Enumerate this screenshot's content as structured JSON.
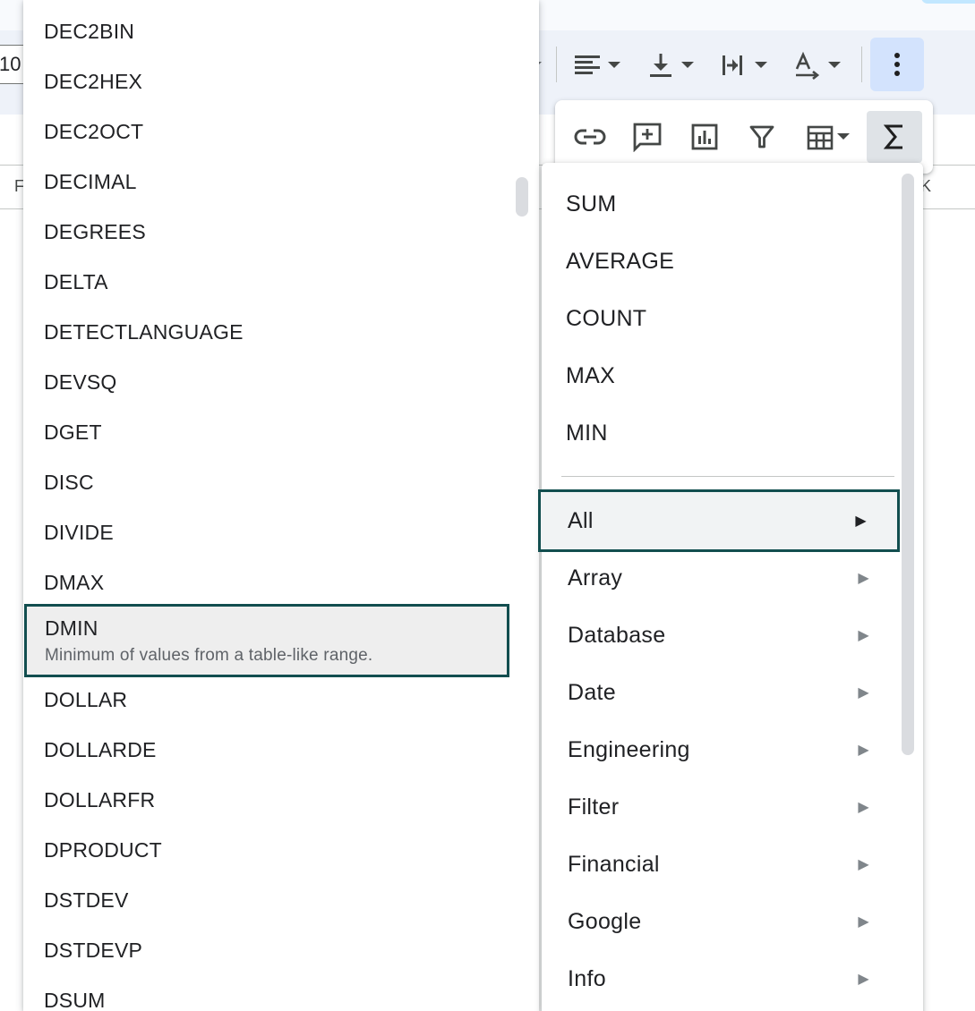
{
  "toolbar": {
    "font_size": "10",
    "col_left": "F",
    "col_right": "K"
  },
  "function_list": {
    "items": [
      {
        "name": "DEC2BIN"
      },
      {
        "name": "DEC2HEX"
      },
      {
        "name": "DEC2OCT"
      },
      {
        "name": "DECIMAL"
      },
      {
        "name": "DEGREES"
      },
      {
        "name": "DELTA"
      },
      {
        "name": "DETECTLANGUAGE"
      },
      {
        "name": "DEVSQ"
      },
      {
        "name": "DGET"
      },
      {
        "name": "DISC"
      },
      {
        "name": "DIVIDE"
      },
      {
        "name": "DMAX"
      },
      {
        "name": "DMIN",
        "description": "Minimum of values from a table-like range."
      },
      {
        "name": "DOLLAR"
      },
      {
        "name": "DOLLARDE"
      },
      {
        "name": "DOLLARFR"
      },
      {
        "name": "DPRODUCT"
      },
      {
        "name": "DSTDEV"
      },
      {
        "name": "DSTDEVP"
      },
      {
        "name": "DSUM"
      }
    ],
    "selected": "DMIN"
  },
  "sum_menu": {
    "quick": [
      "SUM",
      "AVERAGE",
      "COUNT",
      "MAX",
      "MIN"
    ],
    "categories": [
      "All",
      "Array",
      "Database",
      "Date",
      "Engineering",
      "Filter",
      "Financial",
      "Google",
      "Info"
    ],
    "selected_category": "All",
    "arrow": "▶"
  },
  "colors": {
    "selection_border": "#124e4f",
    "active_button": "#d3e3fd"
  }
}
